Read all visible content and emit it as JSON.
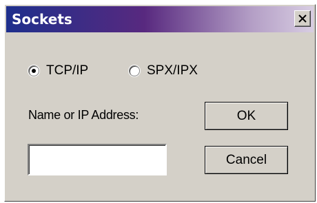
{
  "window": {
    "title": "Sockets",
    "close_label": "×"
  },
  "protocol": {
    "options": [
      {
        "label": "TCP/IP",
        "selected": true
      },
      {
        "label": "SPX/IPX",
        "selected": false
      }
    ]
  },
  "address": {
    "label": "Name or IP Address:",
    "value": ""
  },
  "buttons": {
    "ok_label": "OK",
    "cancel_label": "Cancel"
  },
  "colors": {
    "title_gradient_start": "#1e2f8c",
    "title_gradient_end": "#d8cde2",
    "face": "#d4d0c8"
  },
  "icons": {
    "close": "close-icon",
    "radio_selected": "radio-selected-icon",
    "radio_unselected": "radio-unselected-icon"
  }
}
